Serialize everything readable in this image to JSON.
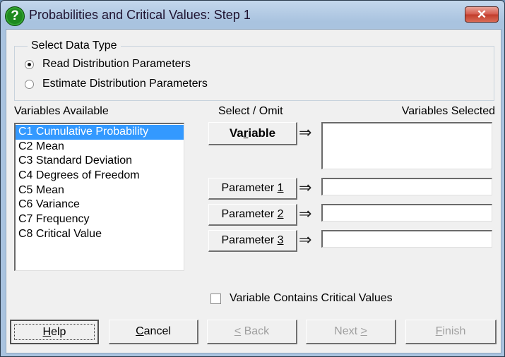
{
  "window": {
    "title": "Probabilities and Critical Values: Step 1",
    "title_icon": "question-icon",
    "close_label": "✕"
  },
  "data_type_group": {
    "legend": "Select Data Type",
    "options": [
      {
        "label": "Read Distribution Parameters",
        "selected": true
      },
      {
        "label": "Estimate Distribution Parameters",
        "selected": false
      }
    ]
  },
  "variables_available": {
    "label": "Variables Available",
    "items": [
      {
        "label": "C1 Cumulative Probability",
        "selected": true
      },
      {
        "label": "C2 Mean",
        "selected": false
      },
      {
        "label": "C3 Standard Deviation",
        "selected": false
      },
      {
        "label": "C4 Degrees of Freedom",
        "selected": false
      },
      {
        "label": "C5 Mean",
        "selected": false
      },
      {
        "label": "C6 Variance",
        "selected": false
      },
      {
        "label": "C7 Frequency",
        "selected": false
      },
      {
        "label": "C8 Critical Value",
        "selected": false
      }
    ]
  },
  "select_omit": {
    "label": "Select / Omit",
    "arrow": "⇒",
    "buttons": [
      {
        "prefix": "Va",
        "mnemonic": "r",
        "suffix": "iable"
      },
      {
        "prefix": "Parameter ",
        "mnemonic": "1",
        "suffix": ""
      },
      {
        "prefix": "Parameter ",
        "mnemonic": "2",
        "suffix": ""
      },
      {
        "prefix": "Parameter ",
        "mnemonic": "3",
        "suffix": ""
      }
    ]
  },
  "variables_selected": {
    "label": "Variables Selected",
    "variable_value": "",
    "parameter1_value": "",
    "parameter2_value": "",
    "parameter3_value": ""
  },
  "critical_values_checkbox": {
    "label": "Variable Contains Critical Values",
    "checked": false
  },
  "footer_buttons": {
    "help": {
      "mnemonic": "H",
      "rest": "elp",
      "enabled": true
    },
    "cancel": {
      "mnemonic": "C",
      "rest": "ancel",
      "enabled": true
    },
    "back": {
      "mnemonic": "<",
      "rest": " Back",
      "enabled": false
    },
    "next": {
      "pre": "Next ",
      "mnemonic": ">",
      "enabled": false
    },
    "finish": {
      "mnemonic": "F",
      "rest": "inish",
      "enabled": false
    }
  }
}
